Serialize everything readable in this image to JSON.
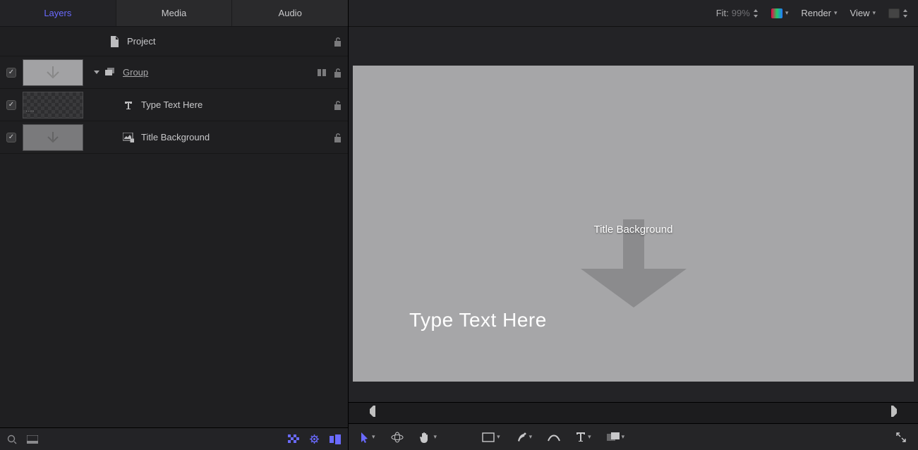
{
  "tabs": {
    "layers": "Layers",
    "media": "Media",
    "audio": "Audio"
  },
  "project_row": {
    "label": "Project"
  },
  "group_row": {
    "label": "Group"
  },
  "text_row": {
    "label": "Type Text Here"
  },
  "titlebg_row": {
    "label": "Title Background"
  },
  "viewer_top": {
    "fit_label": "Fit:",
    "fit_value": "99%",
    "render_label": "Render",
    "view_label": "View"
  },
  "canvas": {
    "bg_label": "Title Background",
    "text_sample": "Type Text Here"
  }
}
